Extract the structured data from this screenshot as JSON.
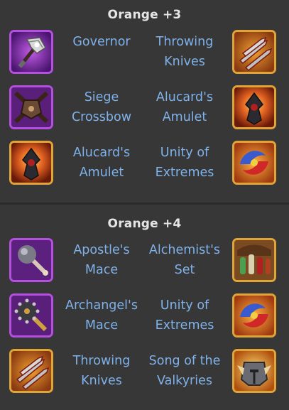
{
  "sections": [
    {
      "title": "Orange +3",
      "rows": [
        {
          "left": {
            "name": "Governor",
            "icon": "governor-axe-icon"
          },
          "right": {
            "name": "Throwing Knives",
            "icon": "throwing-knives-icon"
          }
        },
        {
          "left": {
            "name": "Siege Crossbow",
            "icon": "siege-crossbow-icon"
          },
          "right": {
            "name": "Alucard's Amulet",
            "icon": "alucards-amulet-icon"
          }
        },
        {
          "left": {
            "name": "Alucard's Amulet",
            "icon": "alucards-amulet-icon"
          },
          "right": {
            "name": "Unity of Extremes",
            "icon": "unity-of-extremes-icon"
          }
        }
      ]
    },
    {
      "title": "Orange +4",
      "rows": [
        {
          "left": {
            "name": "Apostle's Mace",
            "icon": "apostles-mace-icon"
          },
          "right": {
            "name": "Alchemist's Set",
            "icon": "alchemists-set-icon"
          }
        },
        {
          "left": {
            "name": "Archangel's Mace",
            "icon": "archangels-mace-icon"
          },
          "right": {
            "name": "Unity of Extremes",
            "icon": "unity-of-extremes-icon"
          }
        },
        {
          "left": {
            "name": "Throwing Knives",
            "icon": "throwing-knives-icon"
          },
          "right": {
            "name": "Song of the Valkyries",
            "icon": "song-of-the-valkyries-icon"
          }
        }
      ]
    }
  ],
  "colors": {
    "background": "#373737",
    "title": "#e6e6e6",
    "label": "#7fb2ea",
    "purple_frame": "#b44fe0",
    "orange_frame": "#e0a536"
  }
}
